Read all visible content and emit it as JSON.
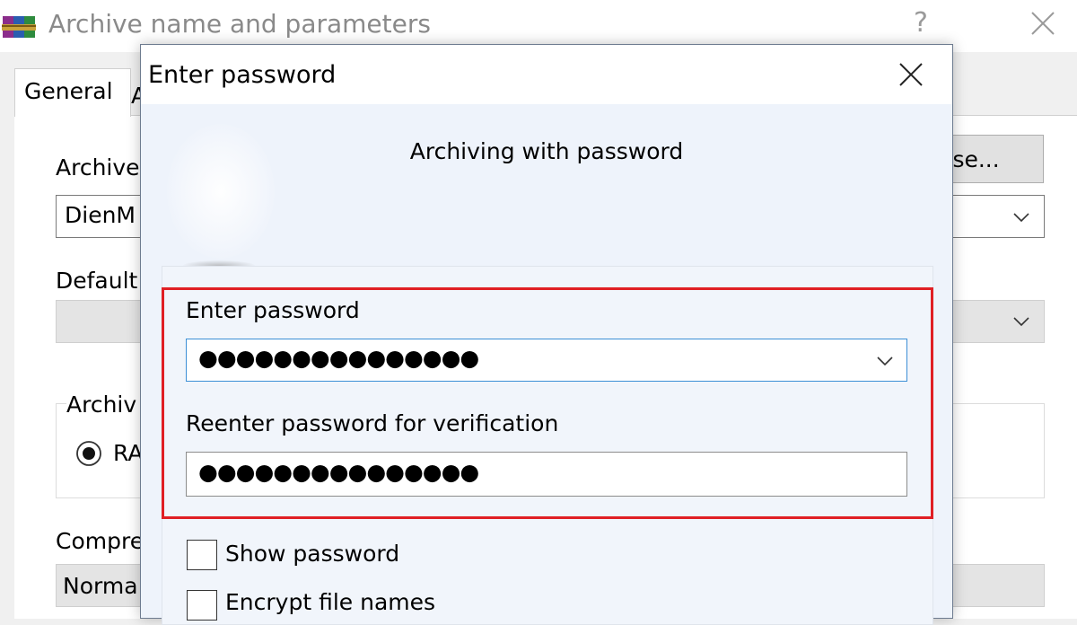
{
  "background_window": {
    "title": "Archive name and parameters",
    "help_glyph": "?",
    "tabs": [
      "General",
      "A"
    ],
    "archive_name_label": "Archive",
    "browse_label": "wse...",
    "archive_name_value": "DienM",
    "default_profile_label": "Default",
    "archive_format_label": "Archiv",
    "radio_label": "RA",
    "compression_label": "Compre",
    "compression_value": "Norma"
  },
  "dialog": {
    "title": "Enter password",
    "heading": "Archiving with password",
    "enter_label": "Enter password",
    "enter_value": "●●●●●●●●●●●●●●●",
    "reenter_label": "Reenter password for verification",
    "reenter_value": "●●●●●●●●●●●●●●●",
    "show_password_label": "Show password",
    "encrypt_names_label": "Encrypt file names"
  },
  "colors": {
    "highlight": "#e01f24",
    "focus_border": "#3c8fd6",
    "dialog_background": "#eef3fb"
  },
  "icons": [
    "winrar-icon",
    "close-icon",
    "chevron-down-icon",
    "radio-selected-icon"
  ]
}
